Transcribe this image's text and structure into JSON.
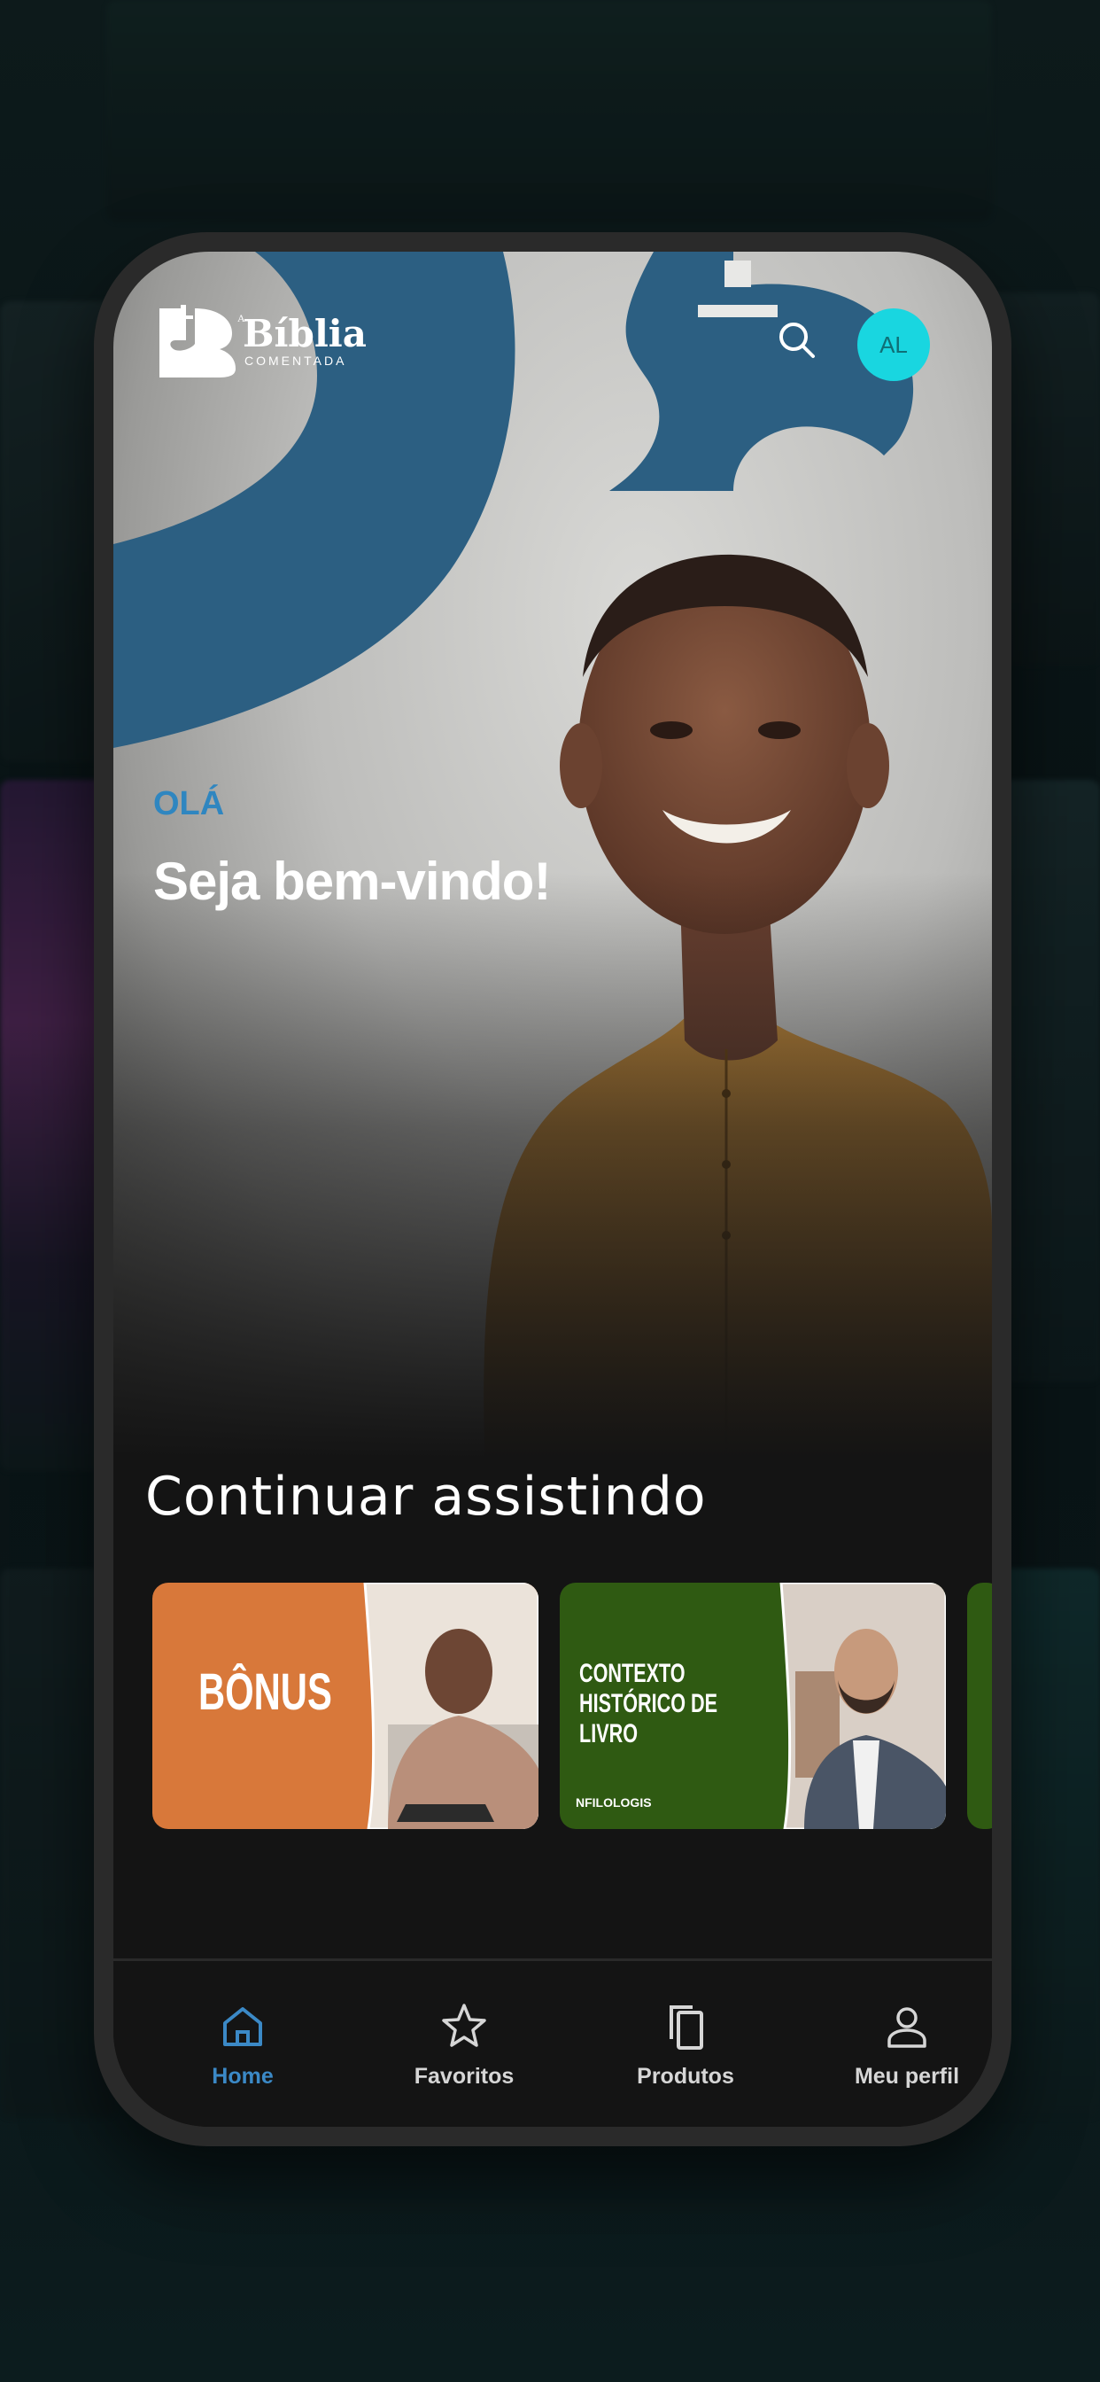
{
  "brand": {
    "prefix": "A",
    "title": "Bíblia",
    "subtitle": "COMENTADA"
  },
  "header": {
    "search_icon": "search-icon",
    "avatar_initials": "AL"
  },
  "hero": {
    "greeting": "OLÁ",
    "welcome": "Seja bem-vindo!"
  },
  "continue_watching": {
    "title": "Continuar assistindo",
    "cards": [
      {
        "label": "BÔNUS",
        "footer": "",
        "color": "#d8783a"
      },
      {
        "label": "CONTEXTO HISTÓRICO DE LIVRO",
        "footer": "NFILOLOGIS",
        "color": "#2f5a12"
      }
    ]
  },
  "nav": {
    "items": [
      {
        "label": "Home",
        "icon": "home-icon",
        "active": true
      },
      {
        "label": "Favoritos",
        "icon": "star-icon",
        "active": false
      },
      {
        "label": "Produtos",
        "icon": "copy-icon",
        "active": false
      },
      {
        "label": "Meu perfil",
        "icon": "user-icon",
        "active": false
      }
    ]
  },
  "colors": {
    "accent": "#19d6e0",
    "active_nav": "#3b89c6",
    "brand_blue": "#2c5f82"
  }
}
